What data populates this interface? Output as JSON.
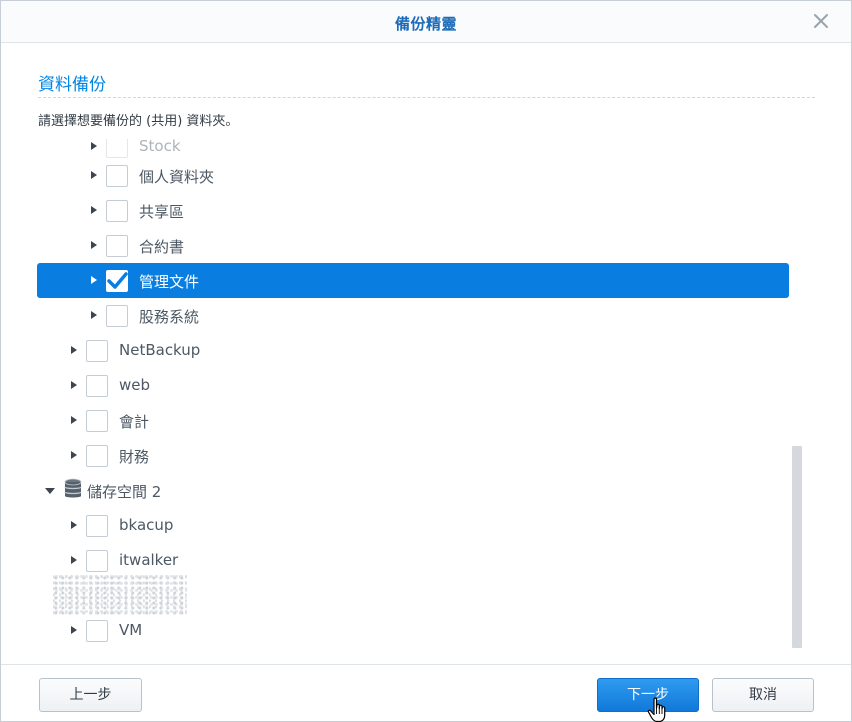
{
  "dialog": {
    "title": "備份精靈",
    "section_title": "資料備份",
    "instruction": "請選擇想要備份的 (共用) 資料夾。"
  },
  "tree": {
    "rows": [
      {
        "label": "Stock",
        "checked": false,
        "selected": false,
        "level": 2,
        "partially_visible": true
      },
      {
        "label": "個人資料夾",
        "checked": false,
        "selected": false,
        "level": 2
      },
      {
        "label": "共享區",
        "checked": false,
        "selected": false,
        "level": 2
      },
      {
        "label": "合約書",
        "checked": false,
        "selected": false,
        "level": 2
      },
      {
        "label": "管理文件",
        "checked": true,
        "selected": true,
        "level": 2
      },
      {
        "label": "股務系統",
        "checked": false,
        "selected": false,
        "level": 2
      },
      {
        "label": "NetBackup",
        "checked": false,
        "selected": false,
        "level": 1
      },
      {
        "label": "web",
        "checked": false,
        "selected": false,
        "level": 1
      },
      {
        "label": "會計",
        "checked": false,
        "selected": false,
        "level": 1
      },
      {
        "label": "財務",
        "checked": false,
        "selected": false,
        "level": 1
      },
      {
        "label": "儲存空間 2",
        "volume": true,
        "expanded": true,
        "level": 0
      },
      {
        "label": "bkacup",
        "checked": false,
        "selected": false,
        "level": 1
      },
      {
        "label": "itwalker",
        "checked": false,
        "selected": false,
        "level": 1
      },
      {
        "label": "",
        "obscured": true,
        "level": 1
      },
      {
        "label": "VM",
        "checked": false,
        "selected": false,
        "level": 1
      }
    ]
  },
  "footer": {
    "back_label": "上一步",
    "next_label": "下一步",
    "cancel_label": "取消"
  },
  "icons": {
    "close": "close-icon",
    "caret_collapsed": "caret-right-icon",
    "caret_expanded": "caret-down-icon",
    "volume": "database-icon",
    "checkmark": "checkmark-icon",
    "cursor": "hand-pointer-icon"
  },
  "colors": {
    "accent": "#0086e5",
    "title": "#1c6bb8",
    "selected_row": "#0a7ee0",
    "primary_button": "#1a86e3"
  }
}
